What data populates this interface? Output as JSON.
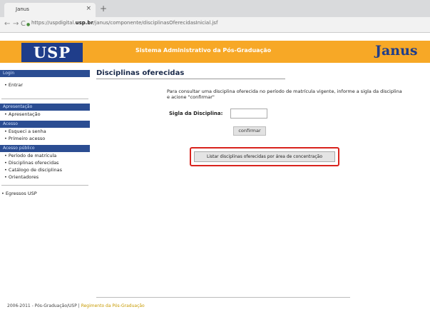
{
  "browser": {
    "tab_title": "Janus",
    "tab_close": "×",
    "new_tab": "+",
    "back": "←",
    "forward": "→",
    "reload": "C",
    "lock": "●",
    "url_prefix": "https://uspdigital.",
    "url_domain": "usp.br",
    "url_path": "/janus/componente/disciplinasOferecidasInicial.jsf"
  },
  "header": {
    "logo_text": "USP",
    "system_title": "Sistema Administrativo da Pós-Graduação",
    "brand": "Janus",
    "color": "#f7a826",
    "logo_color": "#1f3d8a"
  },
  "sidebar": {
    "login_head": "Login",
    "entrar": "• Entrar",
    "sections": [
      {
        "head": "Apresentação",
        "items": [
          "• Apresentação"
        ]
      },
      {
        "head": "Acesso",
        "items": [
          "• Esqueci a senha",
          "• Primeiro acesso"
        ]
      },
      {
        "head": "Acesso público",
        "items": [
          "• Período de matrícula",
          "• Disciplinas oferecidas",
          "• Catálogo de disciplinas",
          "• Orientadores"
        ]
      }
    ],
    "egressos": "• Egressos USP"
  },
  "main": {
    "title": "Disciplinas oferecidas",
    "intro": "Para consultar uma disciplina oferecida no período de matrícula vigente, informe a sigla da disciplina e acione \"confirmar\"",
    "field_label": "Sigla da Disciplina:",
    "field_value": "",
    "confirm_label": "confirmar",
    "list_button_label": "Listar disciplinas oferecidas por área de concentração"
  },
  "footer": {
    "text": "2006-2011 - Pós-Graduação/USP | ",
    "link": "Regimento da Pós-Graduação"
  }
}
